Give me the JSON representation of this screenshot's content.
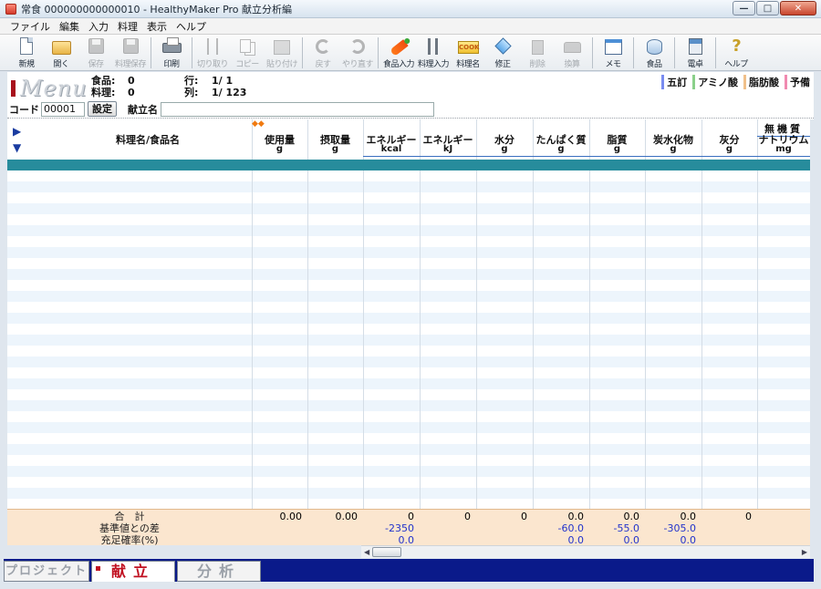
{
  "window": {
    "title": "常食 000000000000010 - HealthyMaker Pro 献立分析編",
    "controls": {
      "minimize": "—",
      "maximize": "□",
      "close": "✕"
    }
  },
  "menubar": [
    "ファイル",
    "編集",
    "入力",
    "料理",
    "表示",
    "ヘルプ"
  ],
  "toolbar": [
    {
      "label": "新規",
      "icon": "new-document-icon",
      "enabled": true
    },
    {
      "label": "開く",
      "icon": "folder-open-icon",
      "enabled": true
    },
    {
      "label": "保存",
      "icon": "save-icon",
      "enabled": false
    },
    {
      "label": "料理保存",
      "icon": "save-recipe-icon",
      "enabled": false
    },
    {
      "label": "印刷",
      "icon": "printer-icon",
      "enabled": true
    },
    {
      "label": "切り取り",
      "icon": "scissors-icon",
      "enabled": false
    },
    {
      "label": "コピー",
      "icon": "copy-icon",
      "enabled": false
    },
    {
      "label": "貼り付け",
      "icon": "paste-icon",
      "enabled": false
    },
    {
      "label": "戻す",
      "icon": "undo-icon",
      "enabled": false
    },
    {
      "label": "やり直す",
      "icon": "redo-icon",
      "enabled": false
    },
    {
      "label": "食品入力",
      "icon": "carrot-icon",
      "enabled": true
    },
    {
      "label": "料理入力",
      "icon": "fork-knife-icon",
      "enabled": true
    },
    {
      "label": "料理名",
      "icon": "cook-icon",
      "enabled": true
    },
    {
      "label": "修正",
      "icon": "edit-diamond-icon",
      "enabled": true
    },
    {
      "label": "削除",
      "icon": "trash-icon",
      "enabled": false
    },
    {
      "label": "換算",
      "icon": "scale-icon",
      "enabled": false
    },
    {
      "label": "メモ",
      "icon": "memo-icon",
      "enabled": true
    },
    {
      "label": "食品",
      "icon": "food-db-icon",
      "enabled": true
    },
    {
      "label": "電卓",
      "icon": "calculator-icon",
      "enabled": true
    },
    {
      "label": "ヘルプ",
      "icon": "help-icon",
      "enabled": true
    }
  ],
  "info": {
    "logo": "Menu",
    "food_label": "食品:",
    "food_count": "0",
    "dish_label": "料理:",
    "dish_count": "0",
    "row_label": "行:",
    "row_value": "1/  1",
    "col_label": "列:",
    "col_value": "1/ 123",
    "legend": [
      {
        "label": "五訂",
        "color": "#7a8cf0"
      },
      {
        "label": "アミノ酸",
        "color": "#8ad08a"
      },
      {
        "label": "脂肪酸",
        "color": "#f0c08a"
      },
      {
        "label": "予備",
        "color": "#f08ab0"
      }
    ],
    "code_label": "コード",
    "code_value": "00001",
    "set_button": "設定",
    "kondate_label": "献立名",
    "kondate_value": ""
  },
  "table": {
    "group_header": "無機質",
    "columns": [
      {
        "name": "料理名/食品名",
        "unit": ""
      },
      {
        "name": "使用量",
        "unit": "g"
      },
      {
        "name": "摂取量",
        "unit": "g"
      },
      {
        "name": "エネルギー",
        "unit": "kcal"
      },
      {
        "name": "エネルギー",
        "unit": "kJ"
      },
      {
        "name": "水分",
        "unit": "g"
      },
      {
        "name": "たんぱく質",
        "unit": "g"
      },
      {
        "name": "脂質",
        "unit": "g"
      },
      {
        "name": "炭水化物",
        "unit": "g"
      },
      {
        "name": "灰分",
        "unit": "g"
      },
      {
        "name": "ナトリウム",
        "unit": "mg"
      }
    ],
    "totals": [
      {
        "label": "合　計",
        "values": [
          "0.00",
          "0.00",
          "0",
          "0",
          "0",
          "0.0",
          "0.0",
          "0.0",
          "0",
          ""
        ]
      },
      {
        "label": "基準値との差",
        "values": [
          "",
          "",
          "-2350",
          "",
          "",
          "-60.0",
          "-55.0",
          "-305.0",
          "",
          ""
        ]
      },
      {
        "label": "充足確率(%)",
        "values": [
          "",
          "",
          "0.0",
          "",
          "",
          "0.0",
          "0.0",
          "0.0",
          "",
          ""
        ]
      }
    ]
  },
  "tabs": [
    {
      "label": "プロジェクト",
      "active": false
    },
    {
      "label": "献立",
      "active": true
    },
    {
      "label": "分析",
      "active": false
    }
  ]
}
